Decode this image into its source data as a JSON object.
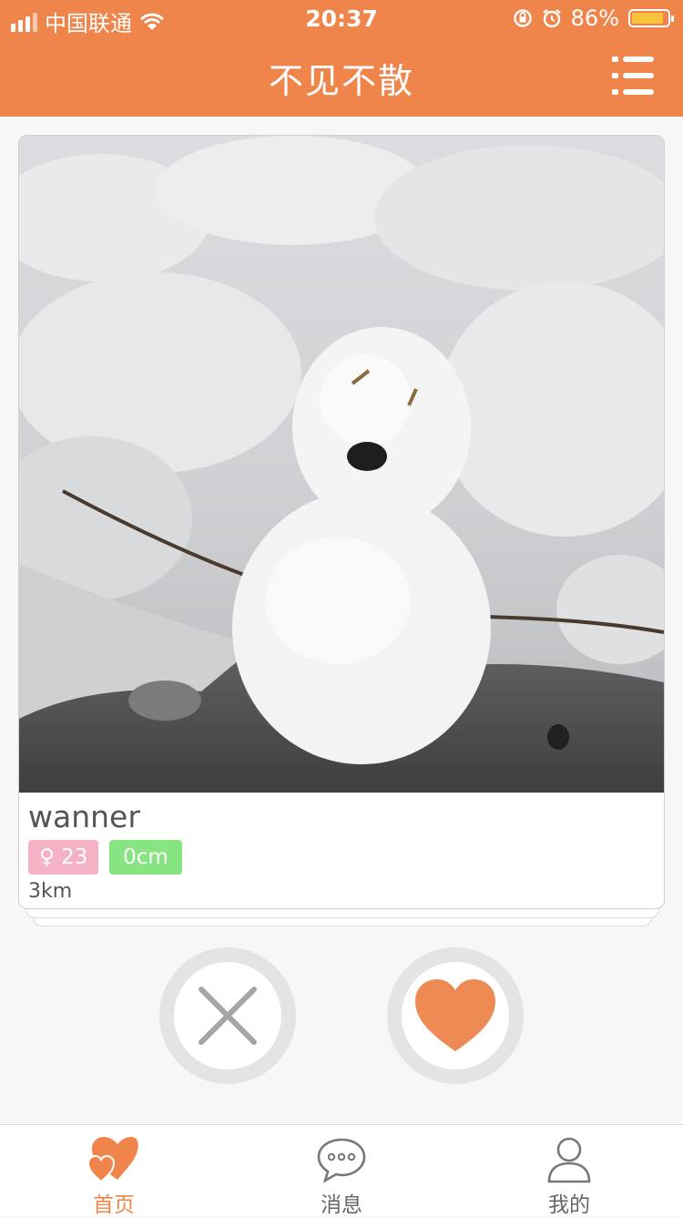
{
  "status_bar": {
    "carrier": "中国联通",
    "time": "20:37",
    "battery": "86%"
  },
  "header": {
    "title": "不见不散",
    "menu_icon": "list-icon"
  },
  "profile": {
    "name": "wanner",
    "gender_age": "♀ 23",
    "height": "0cm",
    "distance": "3km"
  },
  "actions": {
    "dislike_icon": "close-x-icon",
    "like_icon": "heart-icon"
  },
  "tabbar": {
    "items": [
      {
        "label": "首页",
        "icon": "double-heart-icon",
        "active": true
      },
      {
        "label": "消息",
        "icon": "chat-bubble-icon",
        "active": false
      },
      {
        "label": "我的",
        "icon": "person-icon",
        "active": false
      }
    ]
  },
  "colors": {
    "accent": "#f0854b",
    "gender_tag": "#f6b2c5",
    "height_tag": "#86e581",
    "battery_fill": "#f6c33a"
  }
}
